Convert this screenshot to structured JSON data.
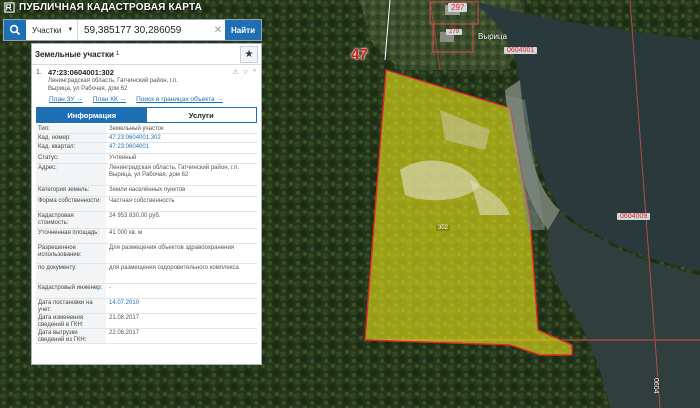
{
  "app": {
    "title": "ПУБЛИЧНАЯ КАДАСТРОВАЯ КАРТА"
  },
  "search": {
    "type_selected": "Участки",
    "query": "59,385177 30,286059",
    "find_label": "Найти"
  },
  "panel": {
    "title": "Земельные участки",
    "count": "1",
    "item_index": "1.",
    "cad_number": "47:23:0604001:302",
    "address_line1": "Ленинградская область, Гатчинский район, г.п.",
    "address_line2": "Вырица, ул Рабочая, дом 62",
    "links": [
      "План ЗУ →",
      "План КК →",
      "Поиск в границах объекта →"
    ],
    "tabs": [
      "Информация",
      "Услуги"
    ],
    "attributes": [
      {
        "key": "Тип:",
        "value": "Земельный участок"
      },
      {
        "key": "Кад. номер:",
        "value": "47:23:0604001:302"
      },
      {
        "key": "Кад. квартал:",
        "value": "47:23:0604001"
      },
      {
        "key": "Статус:",
        "value": "Учтенный"
      },
      {
        "key": "Адрес:",
        "value": "Ленинградская область, Гатчинский район, г.п. Вырица, ул Рабочая, дом 62"
      },
      {
        "key": "Категория земель:",
        "value": "Земли населённых пунктов"
      },
      {
        "key": "Форма собственности:",
        "value": "Частная собственность"
      },
      {
        "key": "Кадастровая стоимость:",
        "value": "24 953 830,00 руб."
      },
      {
        "key": "Уточненная площадь:",
        "value": "41 000 кв. м"
      },
      {
        "key": "Разрешенное использование:",
        "value": "Для размещения объектов здравоохранения"
      },
      {
        "key": "по документу:",
        "value": "для размещения оздоровительного комплекса"
      },
      {
        "key": "Кадастровый инженер:",
        "value": "-"
      },
      {
        "key": "Дата постановки на учет:",
        "value": "14.07.2010"
      },
      {
        "key": "Дата изменения сведений в ГКН:",
        "value": "21.08.2017"
      },
      {
        "key": "Дата выгрузки сведений из ГКН:",
        "value": "22.08.2017"
      }
    ]
  },
  "map": {
    "district_label": "47",
    "town_label": "Вырица",
    "parcel_label": "302",
    "quarter_labels": [
      "0604001",
      "0604009"
    ],
    "building_labels": [
      "297",
      "279"
    ],
    "vertical_label": "0604",
    "parcel_fill": "#e6e21a",
    "boundary_color": "#e2262b"
  },
  "colors": {
    "accent": "#1f6fb5"
  }
}
